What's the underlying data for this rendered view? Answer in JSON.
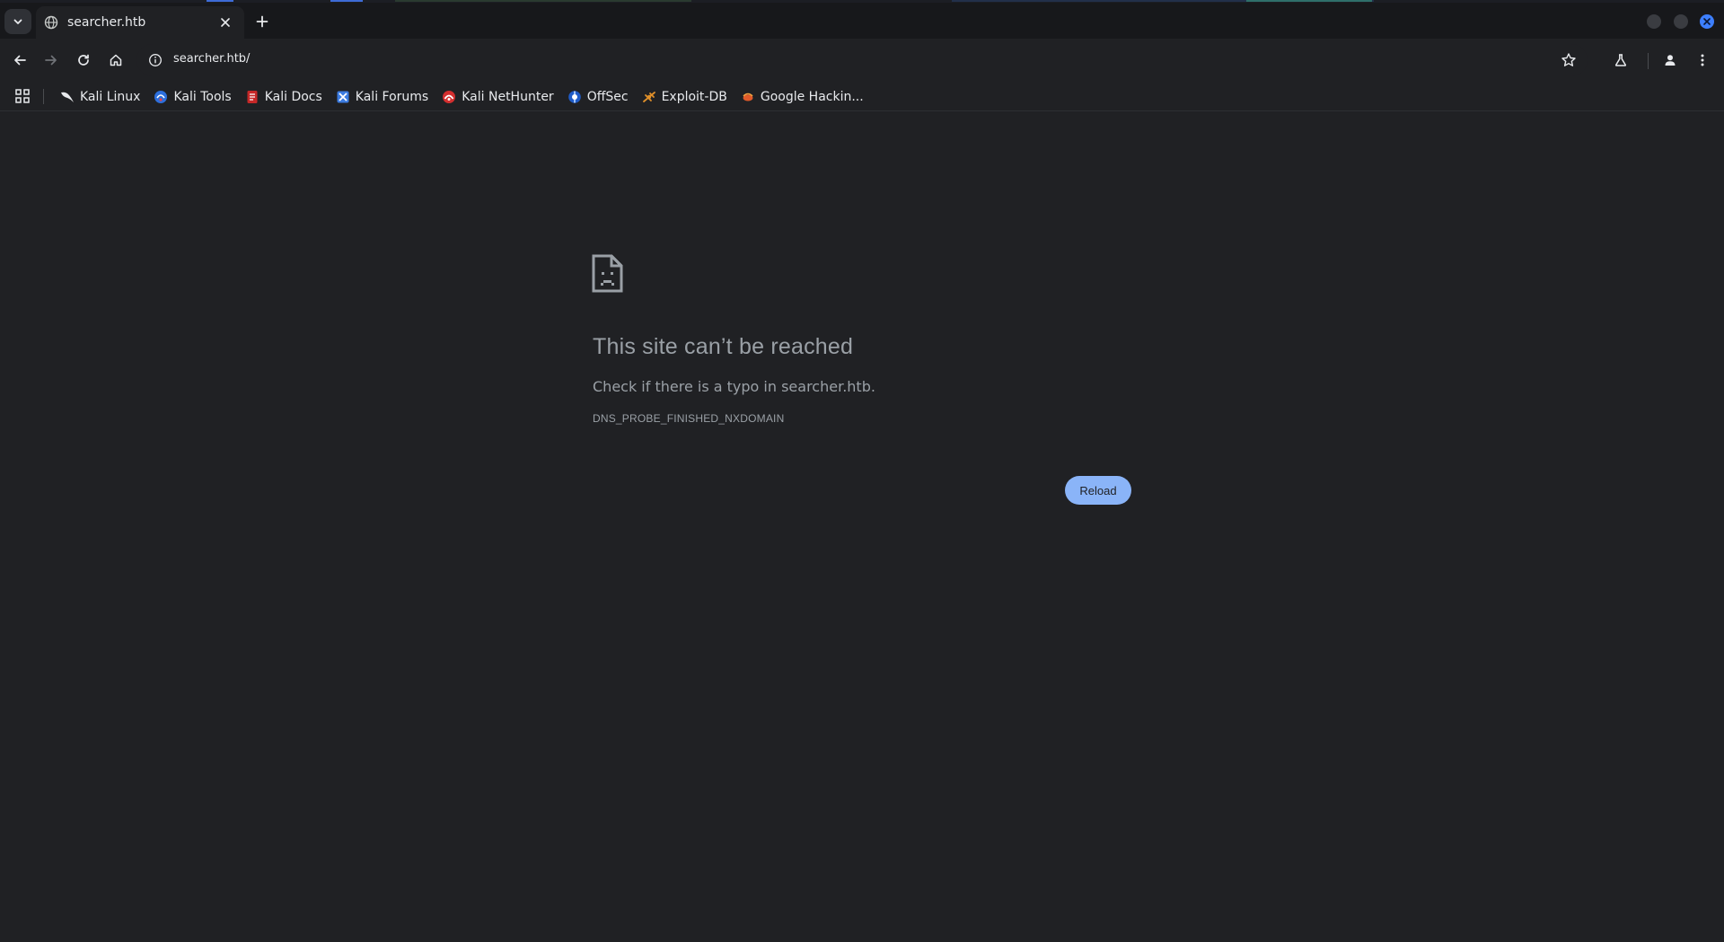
{
  "tab": {
    "title": "searcher.htb"
  },
  "toolbar": {
    "url": "searcher.htb/"
  },
  "bookmarks": [
    {
      "label": "Kali Linux",
      "icon": "kali-dragon-icon"
    },
    {
      "label": "Kali Tools",
      "icon": "kali-tools-icon"
    },
    {
      "label": "Kali Docs",
      "icon": "kali-docs-icon"
    },
    {
      "label": "Kali Forums",
      "icon": "kali-forums-icon"
    },
    {
      "label": "Kali NetHunter",
      "icon": "nethunter-icon"
    },
    {
      "label": "OffSec",
      "icon": "offsec-icon"
    },
    {
      "label": "Exploit-DB",
      "icon": "exploit-db-icon"
    },
    {
      "label": "Google Hackin...",
      "icon": "ghdb-icon"
    }
  ],
  "error": {
    "title": "This site can’t be reached",
    "suggestion": "Check if there is a typo in searcher.htb.",
    "code": "DNS_PROBE_FINISHED_NXDOMAIN",
    "reload_label": "Reload"
  },
  "colors": {
    "page_bg": "#202124",
    "tabstrip_bg": "#17181b",
    "text_primary": "#e8eaed",
    "text_secondary": "#9aa0a6",
    "button_accent": "#8ab4f8",
    "window_close": "#3d7fff"
  }
}
